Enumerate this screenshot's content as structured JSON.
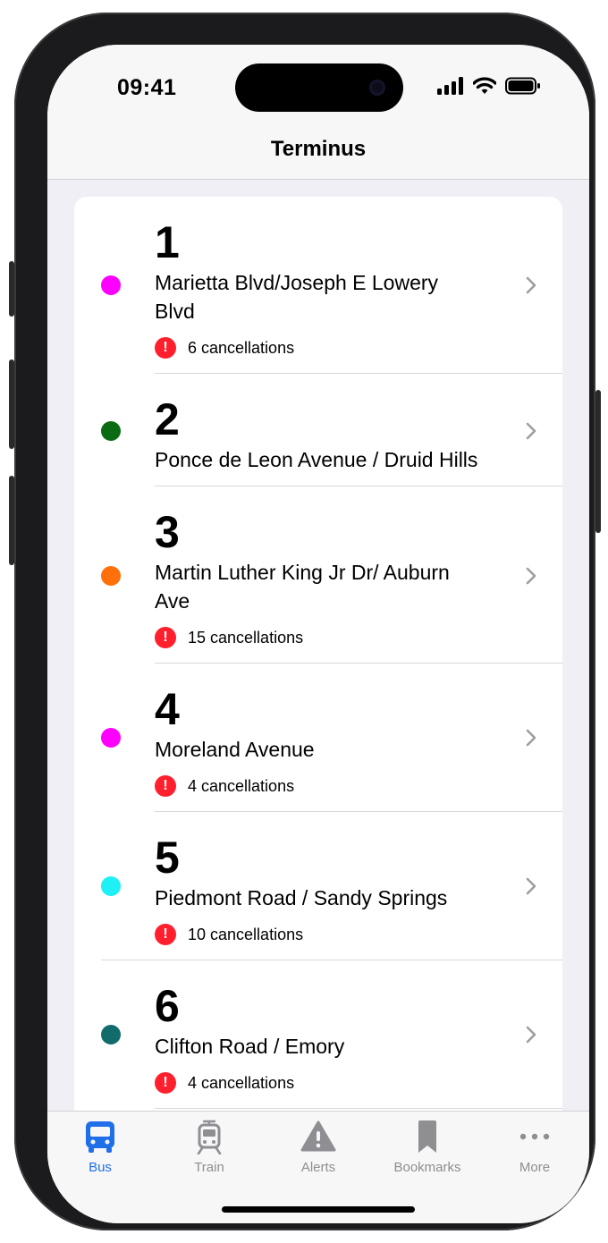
{
  "status": {
    "time": "09:41"
  },
  "nav": {
    "title": "Terminus"
  },
  "routes": [
    {
      "number": "1",
      "name": "Marietta Blvd/Joseph E Lowery Blvd",
      "color": "#ff00ff",
      "alert": "6 cancellations"
    },
    {
      "number": "2",
      "name": "Ponce de Leon Avenue / Druid Hills",
      "color": "#0b6b12",
      "alert": ""
    },
    {
      "number": "3",
      "name": "Martin Luther King Jr Dr/ Auburn Ave",
      "color": "#ff6f0a",
      "alert": "15 cancellations"
    },
    {
      "number": "4",
      "name": "Moreland Avenue",
      "color": "#ff00ff",
      "alert": "4 cancellations"
    },
    {
      "number": "5",
      "name": "Piedmont Road / Sandy Springs",
      "color": "#1ef0f5",
      "alert": "10 cancellations"
    },
    {
      "number": "6",
      "name": "Clifton Road / Emory",
      "color": "#116b6b",
      "alert": "4 cancellations"
    }
  ],
  "alert_symbol": "!",
  "tabs": [
    {
      "label": "Bus",
      "icon": "bus-icon",
      "active": true
    },
    {
      "label": "Train",
      "icon": "train-icon",
      "active": false
    },
    {
      "label": "Alerts",
      "icon": "warning-icon",
      "active": false
    },
    {
      "label": "Bookmarks",
      "icon": "bookmark-icon",
      "active": false
    },
    {
      "label": "More",
      "icon": "more-icon",
      "active": false
    }
  ],
  "colors": {
    "accent": "#1f6fe8",
    "alert": "#ff1f2d",
    "inactive": "#8e8e93"
  }
}
